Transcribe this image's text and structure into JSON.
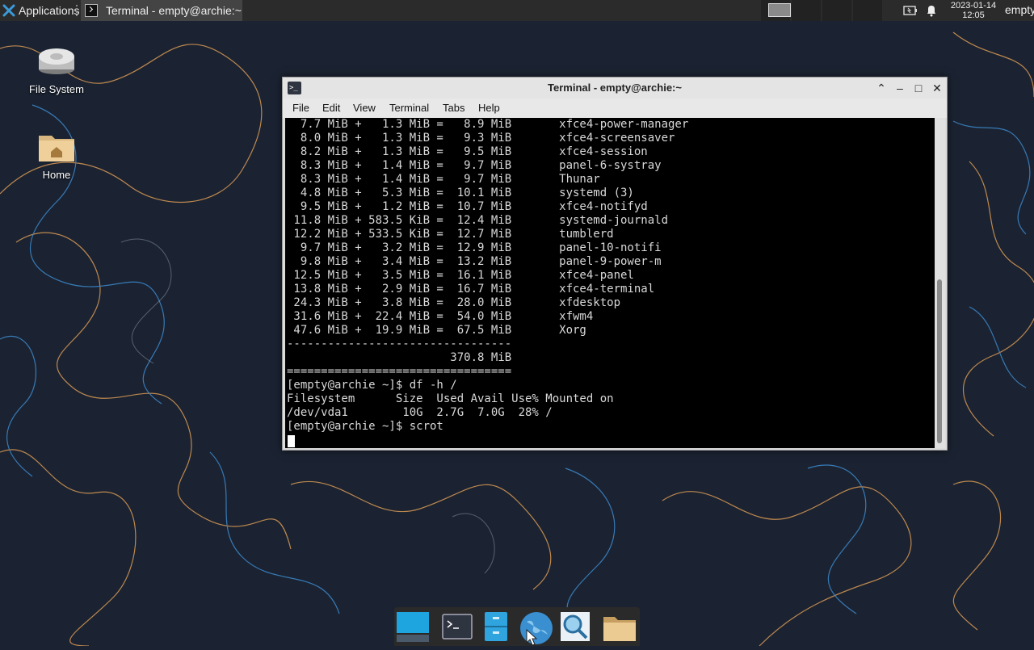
{
  "top_panel": {
    "applications_label": "Applications",
    "task_title": "Terminal - empty@archie:~",
    "clock_date": "2023-01-14",
    "clock_time": "12:05",
    "user": "empty"
  },
  "desktop_icons": [
    {
      "label": "File System",
      "icon": "drive-icon"
    },
    {
      "label": "Home",
      "icon": "home-folder-icon"
    }
  ],
  "terminal": {
    "title": "Terminal - empty@archie:~",
    "menu": [
      "File",
      "Edit",
      "View",
      "Terminal",
      "Tabs",
      "Help"
    ],
    "lines": [
      "  7.7 MiB +   1.3 MiB =   8.9 MiB       xfce4-power-manager",
      "  8.0 MiB +   1.3 MiB =   9.3 MiB       xfce4-screensaver",
      "  8.2 MiB +   1.3 MiB =   9.5 MiB       xfce4-session",
      "  8.3 MiB +   1.4 MiB =   9.7 MiB       panel-6-systray",
      "  8.3 MiB +   1.4 MiB =   9.7 MiB       Thunar",
      "  4.8 MiB +   5.3 MiB =  10.1 MiB       systemd (3)",
      "  9.5 MiB +   1.2 MiB =  10.7 MiB       xfce4-notifyd",
      " 11.8 MiB + 583.5 KiB =  12.4 MiB       systemd-journald",
      " 12.2 MiB + 533.5 KiB =  12.7 MiB       tumblerd",
      "  9.7 MiB +   3.2 MiB =  12.9 MiB       panel-10-notifi",
      "  9.8 MiB +   3.4 MiB =  13.2 MiB       panel-9-power-m",
      " 12.5 MiB +   3.5 MiB =  16.1 MiB       xfce4-panel",
      " 13.8 MiB +   2.9 MiB =  16.7 MiB       xfce4-terminal",
      " 24.3 MiB +   3.8 MiB =  28.0 MiB       xfdesktop",
      " 31.6 MiB +  22.4 MiB =  54.0 MiB       xfwm4",
      " 47.6 MiB +  19.9 MiB =  67.5 MiB       Xorg",
      "---------------------------------",
      "                        370.8 MiB",
      "=================================",
      "[empty@archie ~]$ df -h /",
      "Filesystem      Size  Used Avail Use% Mounted on",
      "/dev/vda1        10G  2.7G  7.0G  28% /",
      "[empty@archie ~]$ scrot"
    ]
  },
  "dock": [
    {
      "name": "show-desktop",
      "icon": "desktop-icon"
    },
    {
      "name": "terminal",
      "icon": "terminal-icon"
    },
    {
      "name": "file-manager",
      "icon": "files-icon"
    },
    {
      "name": "web-browser",
      "icon": "globe-icon"
    },
    {
      "name": "app-finder",
      "icon": "search-icon"
    },
    {
      "name": "home-folder",
      "icon": "folder-icon"
    }
  ],
  "colors": {
    "wallpaper_bg": "#1b2332",
    "wallpaper_orange": "#d99a55",
    "wallpaper_blue": "#3b84c4",
    "panel": "#2b2b2b",
    "terminal_bg": "#000000"
  }
}
